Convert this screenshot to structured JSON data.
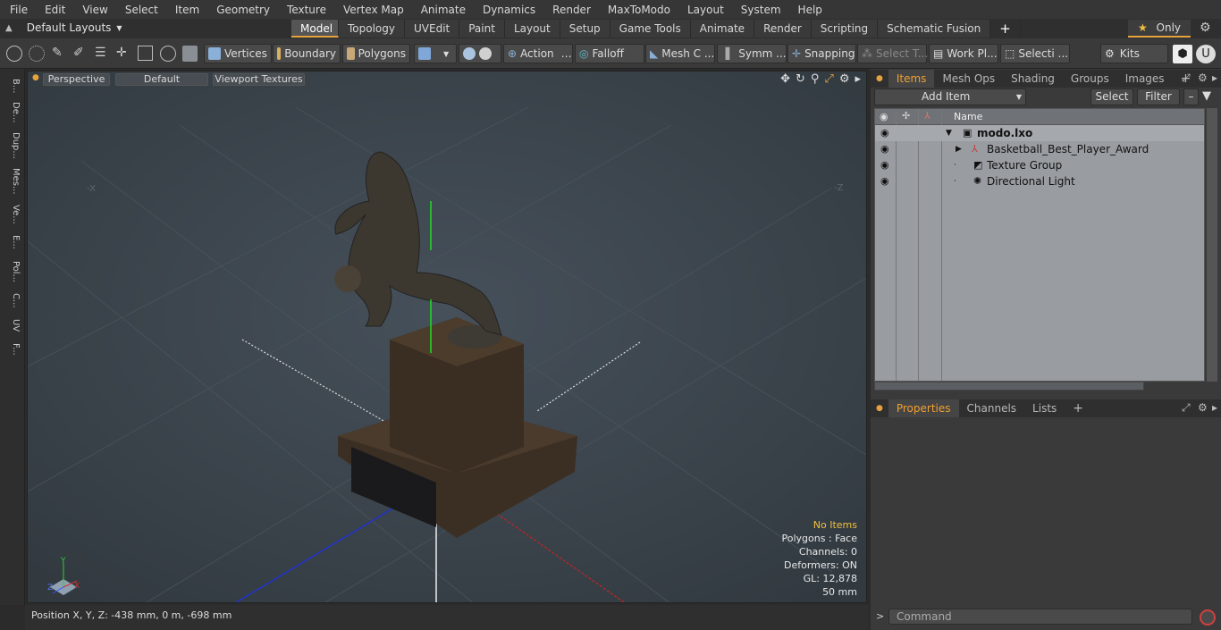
{
  "menu": [
    "File",
    "Edit",
    "View",
    "Select",
    "Item",
    "Geometry",
    "Texture",
    "Vertex Map",
    "Animate",
    "Dynamics",
    "Render",
    "MaxToModo",
    "Layout",
    "System",
    "Help"
  ],
  "layouts_label": "Default Layouts",
  "mode_tabs": [
    "Model",
    "Topology",
    "UVEdit",
    "Paint",
    "Layout",
    "Setup",
    "Game Tools",
    "Animate",
    "Render",
    "Scripting",
    "Schematic Fusion"
  ],
  "active_mode": "Model",
  "only_label": "Only",
  "toolbar": {
    "vertices": "Vertices",
    "boundary": "Boundary",
    "polygons": "Polygons",
    "action": "Action",
    "falloff": "Falloff",
    "mesh_c": "Mesh C ...",
    "symm": "Symm ...",
    "snapping": "Snapping",
    "select_t": "Select T...",
    "work_pl": "Work Pl...",
    "selecti": "Selecti ...",
    "kits": "Kits"
  },
  "left_tabs": [
    "B...",
    "De...",
    "Dup...",
    "Mes...",
    "Ve...",
    "E...",
    "Pol...",
    "C...",
    "UV",
    "F..."
  ],
  "viewport": {
    "perspective": "Perspective",
    "default": "Default",
    "textures": "Viewport Textures",
    "axis_x_label": "-X",
    "axis_z_label": "-Z",
    "info": {
      "no_items": "No Items",
      "polygons": "Polygons : Face",
      "channels": "Channels: 0",
      "deformers": "Deformers: ON",
      "gl": "GL: 12,878",
      "scale": "50 mm"
    }
  },
  "status": "Position X, Y, Z:   -438 mm, 0 m, -698 mm",
  "items_panel": {
    "tabs": [
      "Items",
      "Mesh Ops",
      "Shading",
      "Groups",
      "Images"
    ],
    "add_item": "Add Item",
    "select": "Select",
    "filter": "Filter",
    "name_header": "Name",
    "rows": [
      "modo.lxo",
      "Basketball_Best_Player_Award",
      "Texture Group",
      "Directional Light"
    ]
  },
  "props_panel": {
    "tabs": [
      "Properties",
      "Channels",
      "Lists"
    ]
  },
  "command_placeholder": "Command",
  "colors": {
    "accent": "#e6a23c",
    "viewport_bg": "#3a4349",
    "tree_bg": "#999da1"
  }
}
